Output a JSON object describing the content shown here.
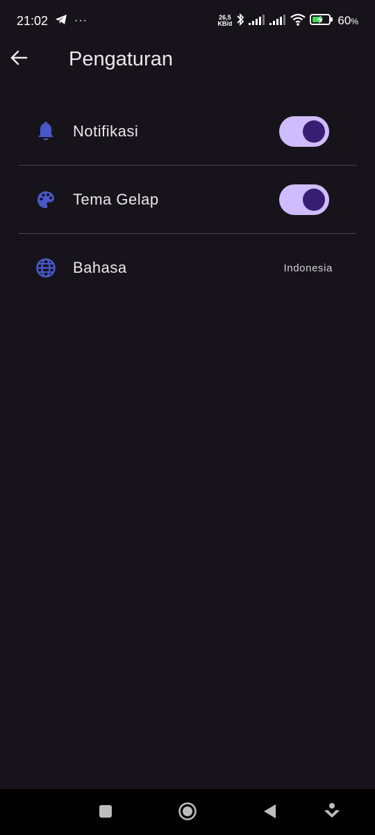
{
  "status_bar": {
    "time": "21:02",
    "more_dots": "···",
    "net_speed_value": "26,5",
    "net_speed_unit": "KB/d",
    "battery_percent": "60",
    "battery_percent_suffix": "%"
  },
  "app_bar": {
    "title": "Pengaturan"
  },
  "settings": {
    "notifications": {
      "label": "Notifikasi",
      "enabled": true,
      "icon": "bell-icon"
    },
    "dark_theme": {
      "label": "Tema Gelap",
      "enabled": true,
      "icon": "palette-icon"
    },
    "language": {
      "label": "Bahasa",
      "value": "Indonesia",
      "icon": "globe-icon"
    }
  },
  "colors": {
    "background": "#16141a",
    "accent_icon": "#4858c8",
    "switch_track": "#cfbcff",
    "switch_thumb": "#381e72",
    "divider": "#48454e"
  }
}
